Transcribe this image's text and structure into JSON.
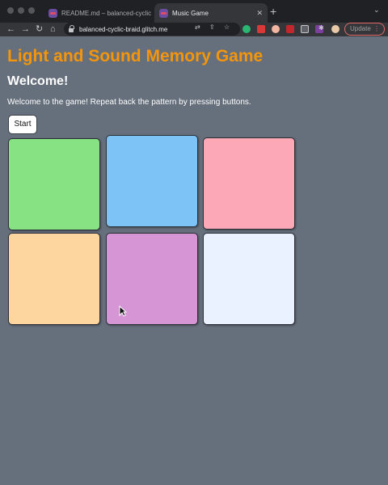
{
  "browser": {
    "tabs": [
      {
        "label": "README.md – balanced-cyclic",
        "close": "✕"
      },
      {
        "label": "Music Game",
        "close": "✕"
      }
    ],
    "new_tab_icon": "+",
    "address": "balanced-cyclic-braid.glitch.me",
    "update_label": "Update"
  },
  "page": {
    "title": "Light and Sound Memory Game",
    "heading": "Welcome!",
    "intro": "Welcome to the game! Repeat back the pattern by pressing buttons.",
    "start_label": "Start"
  },
  "game": {
    "pads": [
      {
        "name": "pad-1",
        "color": "#86e283"
      },
      {
        "name": "pad-2",
        "color": "#7ec3f6"
      },
      {
        "name": "pad-3",
        "color": "#fca8b6"
      },
      {
        "name": "pad-4",
        "color": "#fdd59e"
      },
      {
        "name": "pad-5",
        "color": "#d696d6"
      },
      {
        "name": "pad-6",
        "color": "#eaf2ff"
      }
    ]
  },
  "colors": {
    "page_background": "#666f7c",
    "title": "#f5950b"
  }
}
